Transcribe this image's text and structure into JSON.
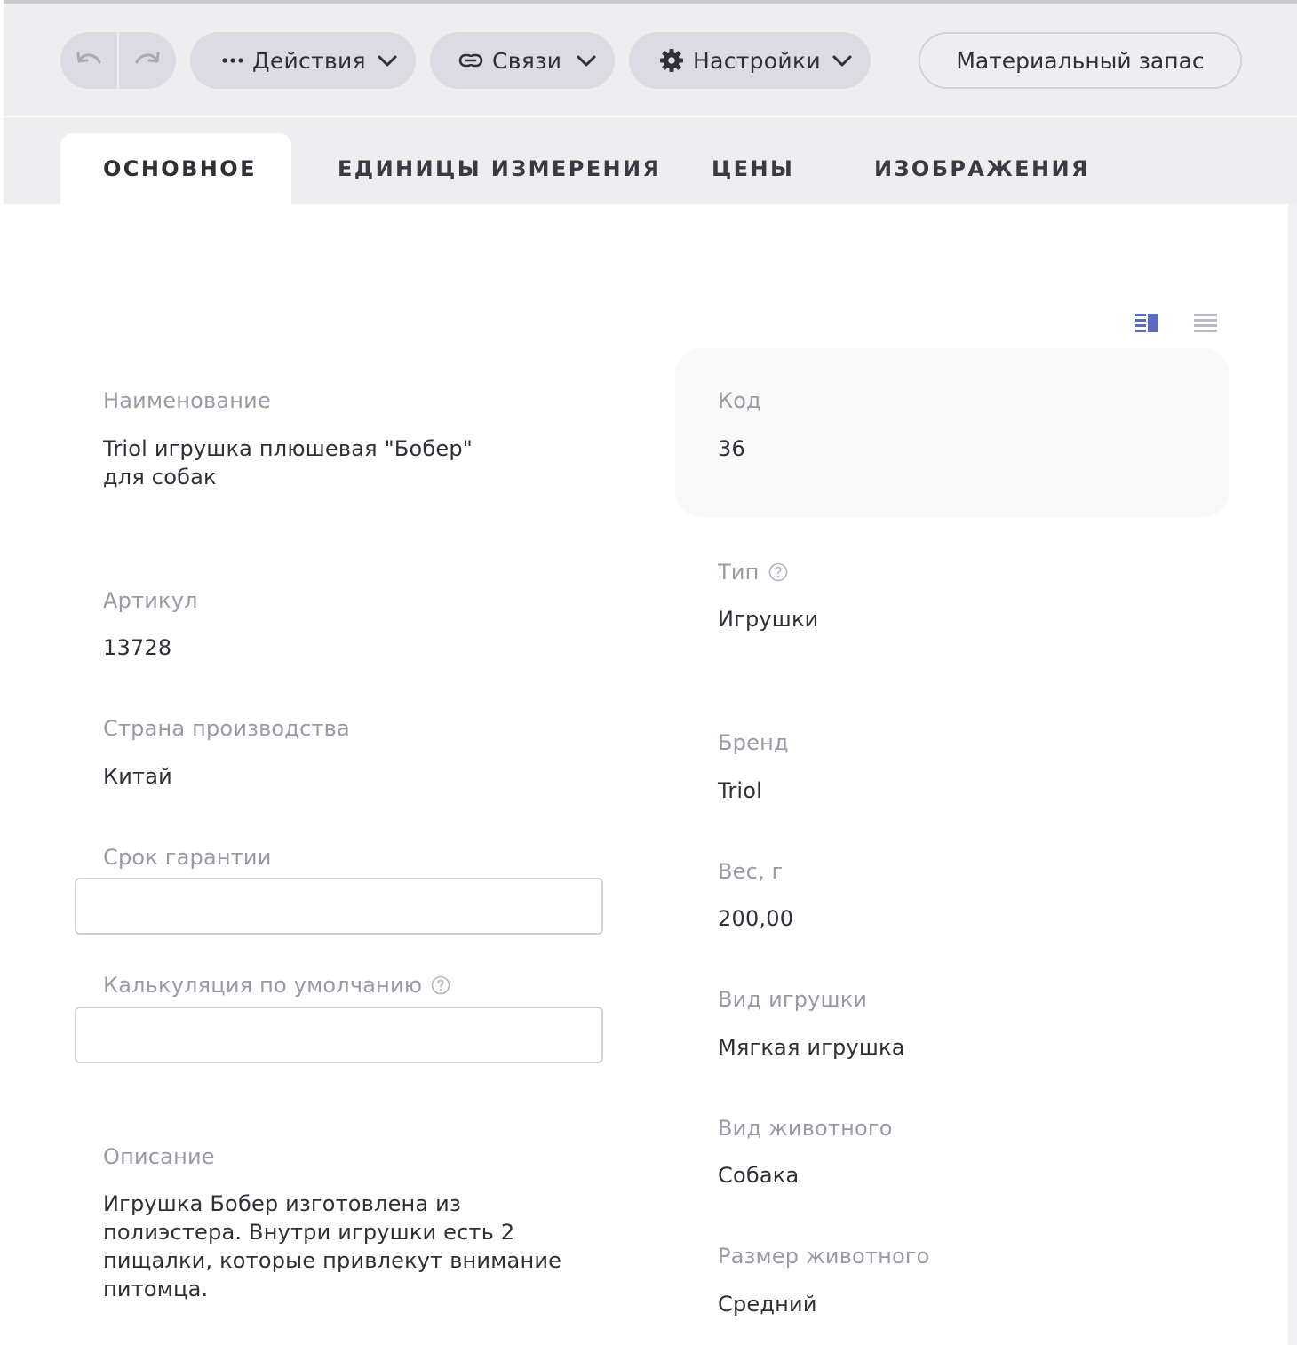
{
  "toolbar": {
    "actions_label": "Действия",
    "links_label": "Связи",
    "settings_label": "Настройки",
    "stock_label": "Материальный запас"
  },
  "tabs": [
    {
      "label": "ОСНОВНОЕ",
      "active": true
    },
    {
      "label": "ЕДИНИЦЫ ИЗМЕРЕНИЯ",
      "active": false
    },
    {
      "label": "ЦЕНЫ",
      "active": false
    },
    {
      "label": "ИЗОБРАЖЕНИЯ",
      "active": false
    }
  ],
  "form": {
    "name": {
      "label": "Наименование",
      "value": "Triol игрушка плюшевая \"Бобер\"  для собак"
    },
    "code": {
      "label": "Код",
      "value": "36"
    },
    "type": {
      "label": "Тип",
      "value": "Игрушки"
    },
    "article": {
      "label": "Артикул",
      "value": "13728"
    },
    "country": {
      "label": "Страна производства",
      "value": "Китай"
    },
    "brand": {
      "label": "Бренд",
      "value": "Triol"
    },
    "warranty": {
      "label": "Срок гарантии",
      "value": ""
    },
    "weight": {
      "label": "Вес, г",
      "value": "200,00"
    },
    "calculation": {
      "label": "Калькуляция по умолчанию",
      "value": ""
    },
    "toy_kind": {
      "label": "Вид игрушки",
      "value": "Мягкая игрушка"
    },
    "animal_kind": {
      "label": "Вид животного",
      "value": "Собака"
    },
    "description": {
      "label": "Описание",
      "value": "Игрушка Бобер изготовлена из полиэстера. Внутри игрушки есть 2 пищалки, которые привлекут внимание питомца."
    },
    "animal_size": {
      "label": "Размер животного",
      "value": "Средний"
    }
  },
  "colors": {
    "accent": "#5b6bbf",
    "pill_bg": "#dcdbe3",
    "label_gray": "#9a9aa6"
  }
}
